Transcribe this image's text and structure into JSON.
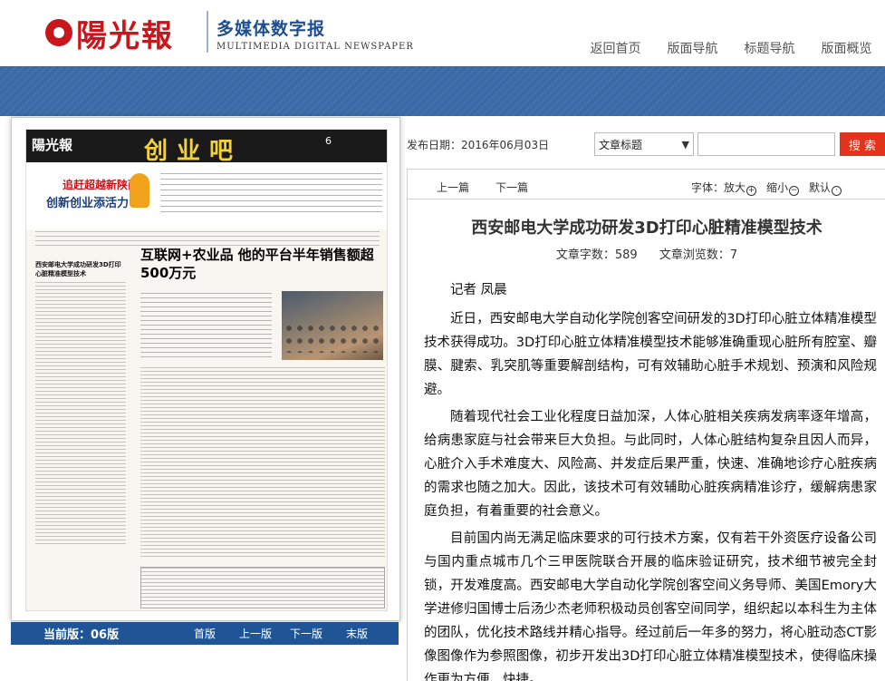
{
  "header": {
    "logo_text": "陽光報",
    "brand_cn": "多媒体数字报",
    "brand_en": "MULTIMEDIA DIGITAL NEWSPAPER",
    "nav": [
      "返回首页",
      "版面导航",
      "标题导航",
      "版面概览"
    ]
  },
  "page_image": {
    "masthead_left": "陽光報",
    "masthead_title": "创业吧",
    "masthead_num": "6",
    "promo_t1": "追赶超越新陕西",
    "promo_t2": "创新创业添活力",
    "left_article_title": "西安邮电大学成功研发3D打印心脏精准模型技术",
    "headline": "互联网+农业品 他的平台半年销售额超500万元"
  },
  "pager": {
    "current_label": "当前版：06版",
    "links": [
      "首版",
      "上一版",
      "下一版",
      "末版"
    ]
  },
  "search": {
    "date_label": "发布日期：2016年06月03日",
    "select_value": "文章标题",
    "input_value": "",
    "button_label": "搜 索"
  },
  "article": {
    "prev": "上一篇",
    "next": "下一篇",
    "font_label": "字体：",
    "font_bigger": "放大",
    "font_smaller": "缩小",
    "font_default": "默认",
    "title": "西安邮电大学成功研发3D打印心脏精准模型技术",
    "word_count": "文章字数：589",
    "views": "文章浏览数：7",
    "byline": "记者 凤晨",
    "paragraphs": [
      "近日，西安邮电大学自动化学院创客空间研发的3D打印心脏立体精准模型技术获得成功。3D打印心脏立体精准模型技术能够准确重现心脏所有腔室、瓣膜、腱索、乳突肌等重要解剖结构，可有效辅助心脏手术规划、预演和风险规避。",
      "随着现代社会工业化程度日益加深，人体心脏相关疾病发病率逐年增高，给病患家庭与社会带来巨大负担。与此同时，人体心脏结构复杂且因人而异，心脏介入手术难度大、风险高、并发症后果严重，快速、准确地诊疗心脏疾病的需求也随之加大。因此，该技术可有效辅助心脏疾病精准诊疗，缓解病患家庭负担，有着重要的社会意义。",
      "目前国内尚无满足临床要求的可行技术方案，仅有若干外资医疗设备公司与国内重点城市几个三甲医院联合开展的临床验证研究，技术细节被完全封锁，开发难度高。西安邮电大学自动化学院创客空间义务导师、美国Emory大学进修归国博士后汤少杰老师积极动员创客空间同学，组织起以本科生为主体的团队，优化技术路线并精心指导。经过前后一年多的努力，将心脏动态CT影像图像作为参照图像，初步开发出3D打印心脏立体精准模型技术，使得临床操作更为方便、快捷。"
    ]
  }
}
